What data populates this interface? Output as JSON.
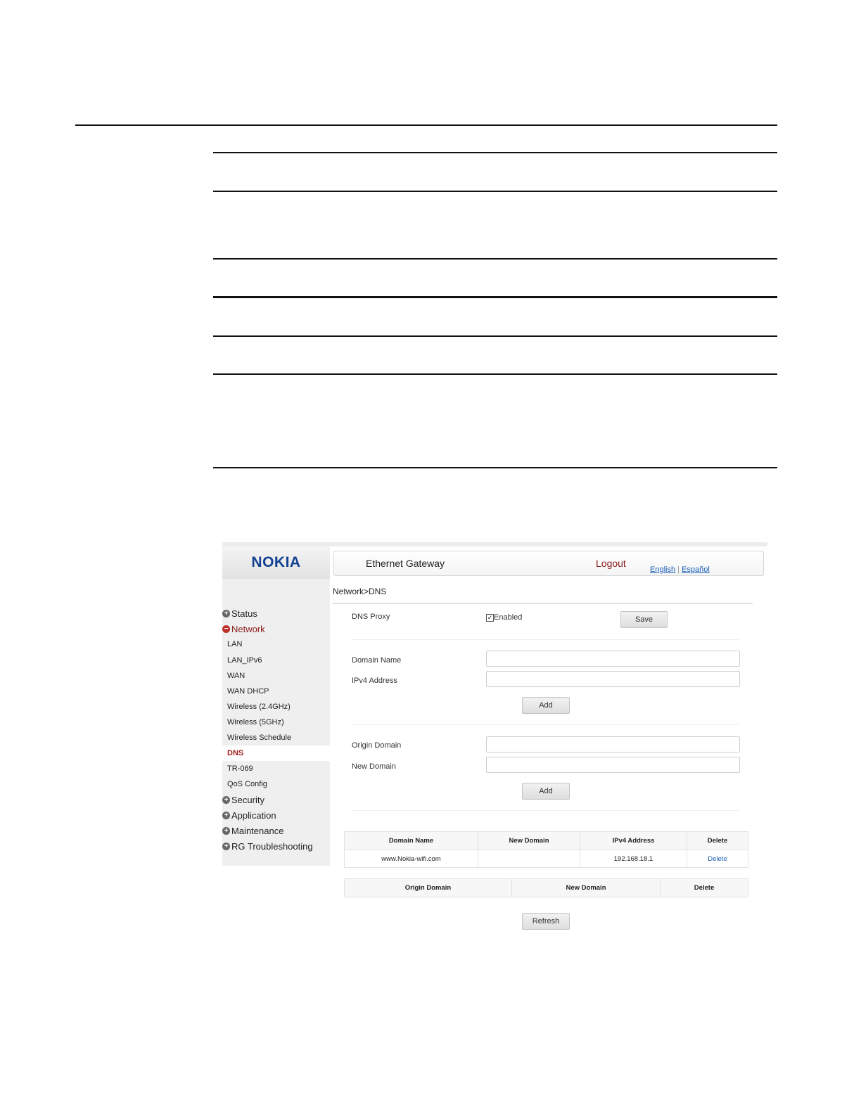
{
  "header": {
    "title": "Ethernet Gateway",
    "logout": "Logout",
    "lang_english": "English",
    "lang_sep": "|",
    "lang_espanol": "Español"
  },
  "logo": "NOKIA",
  "breadcrumb": "Network>DNS",
  "sidebar": {
    "status": "Status",
    "network": "Network",
    "sub_items": [
      "LAN",
      "LAN_IPv6",
      "WAN",
      "WAN DHCP",
      "Wireless (2.4GHz)",
      "Wireless (5GHz)",
      "Wireless Schedule",
      "DNS",
      "TR-069",
      "QoS Config"
    ],
    "security": "Security",
    "application": "Application",
    "maintenance": "Maintenance",
    "rg_troubleshooting": "RG Troubleshooting"
  },
  "dns_proxy": {
    "label": "DNS Proxy",
    "checkbox_label": "Enabled",
    "checked": true,
    "save": "Save"
  },
  "host_form": {
    "domain_name_label": "Domain Name",
    "domain_name_value": "",
    "ipv4_label": "IPv4 Address",
    "ipv4_value": "",
    "add": "Add"
  },
  "rename_form": {
    "origin_label": "Origin Domain",
    "origin_value": "",
    "new_label": "New Domain",
    "new_value": "",
    "add": "Add"
  },
  "host_table": {
    "headers": [
      "Domain Name",
      "New Domain",
      "IPv4 Address",
      "Delete"
    ],
    "rows": [
      {
        "domain": "www.Nokia-wifi.com",
        "new_domain": "",
        "ipv4": "192.168.18.1",
        "delete": "Delete"
      }
    ]
  },
  "rename_table": {
    "headers": [
      "Origin Domain",
      "New Domain",
      "Delete"
    ]
  },
  "refresh": "Refresh"
}
